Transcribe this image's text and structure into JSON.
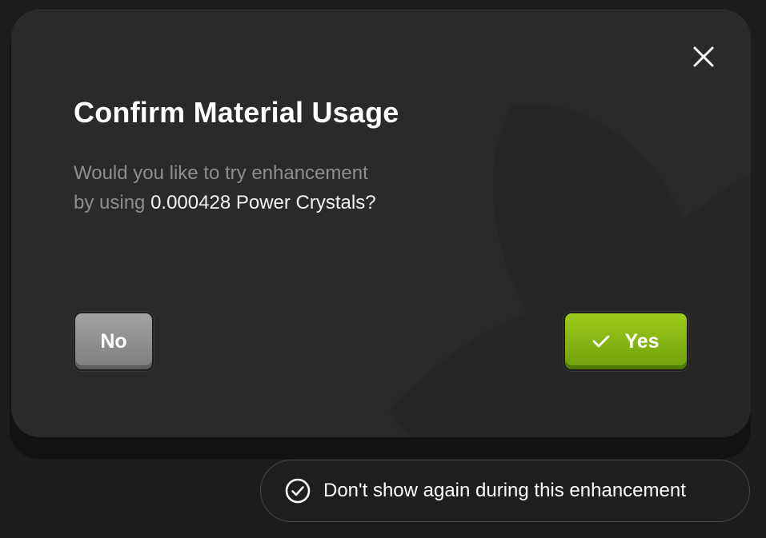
{
  "dialog": {
    "title": "Confirm Material Usage",
    "message_line1": "Would you like to try enhancement",
    "message_prefix": "by using ",
    "message_highlight": "0.000428 Power Crystals?",
    "close_icon": "close-icon",
    "buttons": {
      "no_label": "No",
      "yes_label": "Yes",
      "yes_icon": "checkmark-icon"
    }
  },
  "dont_show_again": {
    "label": "Don't show again during this enhancement",
    "icon": "circle-check-icon"
  },
  "colors": {
    "background": "#1c1c1c",
    "dialog": "#2a2a2a",
    "yes_button": "#8cbc13",
    "no_button": "#8f8f8f",
    "message_text": "#8e8e8e",
    "highlight_text": "#f2f2f2"
  }
}
